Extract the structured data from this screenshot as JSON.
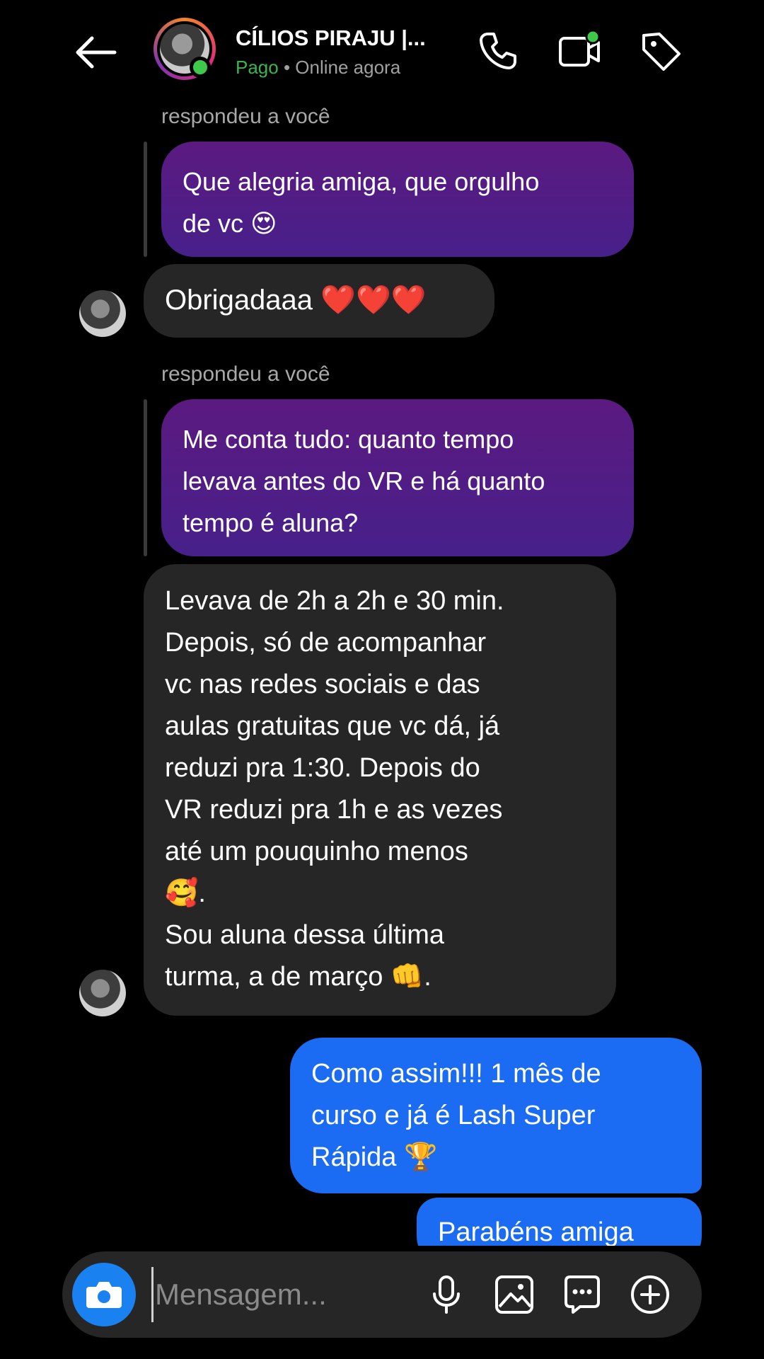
{
  "header": {
    "title": "CÍLIOS PIRAJU |...",
    "status_paid": "Pago",
    "status_sep": " • ",
    "status_online": "Online agora",
    "icons": [
      "back-arrow-icon",
      "phone-icon",
      "video-call-icon",
      "tag-icon"
    ]
  },
  "messages": [
    {
      "reply_label": "respondeu a você",
      "text": "Que alegria amiga, que orgulho\nde vc 😍"
    },
    {
      "text": "Obrigadaaa ❤️❤️❤️"
    },
    {
      "reply_label": "respondeu a você",
      "text": "Me conta tudo: quanto tempo\nlevava antes do VR e há quanto\ntempo é aluna?"
    },
    {
      "text": "Levava de 2h a 2h e 30 min.\nDepois, só de acompanhar\nvc nas redes sociais e das\naulas gratuitas que vc dá, já\nreduzi pra 1:30. Depois do\nVR reduzi pra 1h e as vezes\naté um pouquinho menos\n🥰.\nSou aluna dessa última\nturma, a de março 👊."
    },
    {
      "text": "Como assim!!! 1 mês de\ncurso e já é Lash Super\nRápida 🏆"
    },
    {
      "text": "Parabéns amiga"
    }
  ],
  "composer": {
    "placeholder": "Mensagem...",
    "icons": [
      "camera-icon",
      "microphone-icon",
      "gallery-icon",
      "sticker-icon",
      "plus-icon"
    ]
  },
  "colors": {
    "background": "#000000",
    "incoming_bubble": "#262626",
    "outgoing_bubble": "#1b6cf2",
    "quoted_bubble": "#5b1a80",
    "camera_button": "#1a82f0",
    "online": "#3ec94a",
    "paid": "#3bb54a"
  }
}
